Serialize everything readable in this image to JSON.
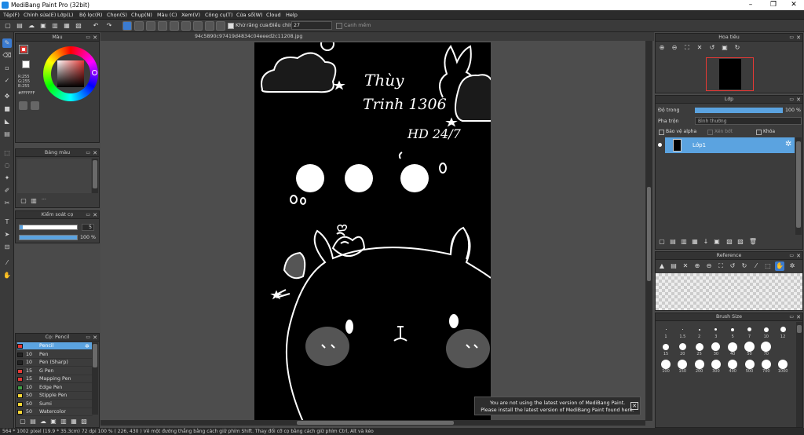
{
  "window": {
    "title": "MediBang Paint Pro (32bit)",
    "minimize": "–",
    "maximize": "❐",
    "close": "✕"
  },
  "menu": [
    "Tệp(F)",
    "Chỉnh sửa(E)",
    "Lớp(L)",
    "Bộ lọc(R)",
    "Chọn(S)",
    "Chụp(N)",
    "Màu (C)",
    "Xem(V)",
    "Công cụ(T)",
    "Cửa sổ(W)",
    "Cloud",
    "Help"
  ],
  "toolbar": {
    "antialias_label": "Khử răng cưa",
    "correction_label": "Điều chỉnh",
    "correction_value": "27",
    "edge_label": "Canh mềm"
  },
  "document": {
    "filename": "94c5890c97419d4834c04eeed2c11208.jpg"
  },
  "color_panel": {
    "title": "Màu",
    "r": "R:255",
    "g": "G:255",
    "b": "B:255",
    "hex": "#FFFFFF",
    "fg": "#ffffff",
    "bg": "#ffffff"
  },
  "palette_panel": {
    "title": "Bảng màu",
    "dots": "···"
  },
  "brush_control": {
    "title": "Kiểm soát cọ",
    "size_value": "5",
    "opacity_value": "100 %",
    "size_fraction": 0.05,
    "opacity_fraction": 1.0
  },
  "brush_panel": {
    "title": "Cọ: Pencil",
    "items": [
      {
        "size": "",
        "name": "Pencil",
        "color": "#e53935"
      },
      {
        "size": "10",
        "name": "Pen",
        "color": "#222222"
      },
      {
        "size": "10",
        "name": "Pen (Sharp)",
        "color": "#222222"
      },
      {
        "size": "15",
        "name": "G Pen",
        "color": "#e53935"
      },
      {
        "size": "15",
        "name": "Mapping Pen",
        "color": "#e53935"
      },
      {
        "size": "10",
        "name": "Edge Pen",
        "color": "#43a047"
      },
      {
        "size": "50",
        "name": "Stipple Pen",
        "color": "#fdd835"
      },
      {
        "size": "50",
        "name": "Sumi",
        "color": "#fdd835"
      },
      {
        "size": "50",
        "name": "Watercolor",
        "color": "#fdd835"
      }
    ]
  },
  "navigator": {
    "title": "Hoa tiêu"
  },
  "layer_panel": {
    "title": "Lớp",
    "opacity_label": "Độ trong",
    "opacity_value": "100 %",
    "blend_label": "Pha trộn",
    "blend_value": "Bình thường",
    "alpha_label": "Bảo vệ alpha",
    "clip_label": "Xén bớt",
    "lock_label": "Khóa",
    "layer_name": "Lớp1",
    "opacity_fraction": 1.0
  },
  "reference_panel": {
    "title": "Reference"
  },
  "brushsize_panel": {
    "title": "Brush Size",
    "sizes": [
      "1",
      "1.5",
      "2",
      "3",
      "5",
      "7",
      "10",
      "12",
      "15",
      "20",
      "25",
      "30",
      "40",
      "50",
      "70",
      "100",
      "150",
      "200",
      "300",
      "400",
      "500",
      "700",
      "1000"
    ]
  },
  "canvas_text": {
    "line1": "Thùy",
    "line2": "Trinh 1306",
    "line3": "HD 24/7"
  },
  "notice": {
    "line1": "You are not using the latest version of MediBang Paint.",
    "line2": "Please install the latest version of MediBang Paint found here.",
    "close": "✕"
  },
  "statusbar": {
    "text": "564 * 1002 pixel   (19.9 * 35.3cm)   72 dpi   100 %   ( 226, 430 )   Vẽ một đường thẳng bằng cách giữ phím Shift. Thay đổi cỡ cọ bằng cách giữ phím Ctrl, Alt và kéo"
  }
}
